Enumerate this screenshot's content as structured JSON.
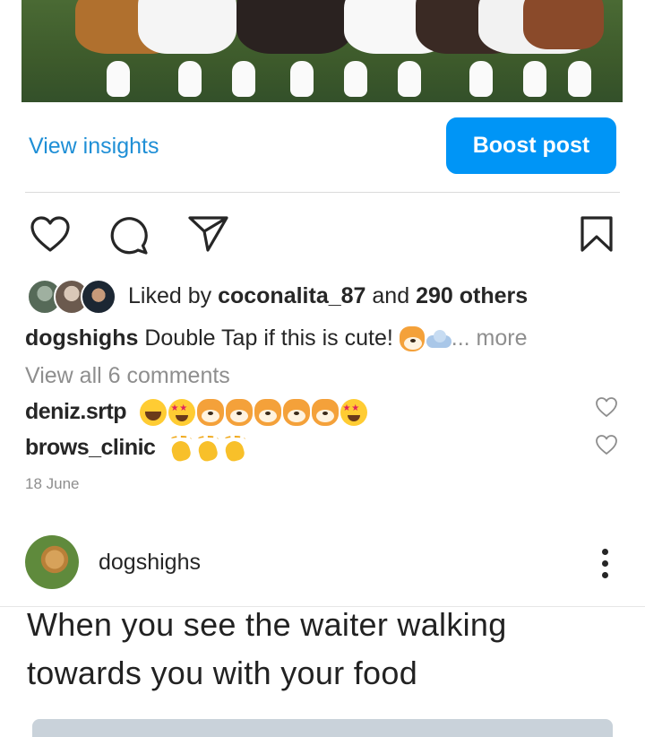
{
  "actions": {
    "insights_label": "View insights",
    "boost_label": "Boost post"
  },
  "likes": {
    "prefix": "Liked by",
    "user": "coconalita_87",
    "connector": "and",
    "others": "290 others"
  },
  "caption": {
    "user": "dogshighs",
    "text": "Double Tap if this is cute!",
    "more": "... more"
  },
  "comments": {
    "view_all": "View all 6 comments",
    "items": [
      {
        "user": "deniz.srtp"
      },
      {
        "user": "brows_clinic"
      }
    ]
  },
  "post_date": "18 June",
  "next_post": {
    "username": "dogshighs",
    "meme_text": "When you see the waiter walking towards you with your food"
  },
  "colors": {
    "accent": "#0095f6",
    "link": "#1f8fd6",
    "muted": "#8e8e8e",
    "text": "#262626"
  },
  "icons": [
    "heart-icon",
    "comment-icon",
    "share-icon",
    "bookmark-icon",
    "kebab-menu-icon"
  ]
}
